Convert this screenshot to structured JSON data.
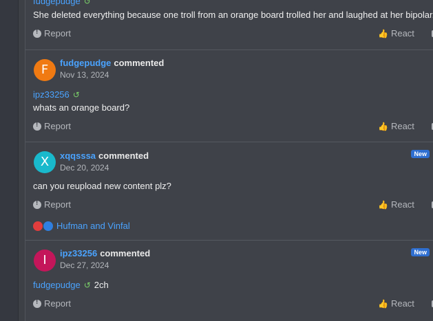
{
  "comments": [
    {
      "reply_to": "fudgepudge",
      "text": "She deleted everything because one troll from an orange board trolled her and laughed at her bipolar.",
      "report": "Report",
      "react": "React"
    },
    {
      "author": "fudgepudge",
      "verb": "commented",
      "date": "Nov 13, 2024",
      "avatar_letter": "F",
      "avatar_color": "#f07a12",
      "reply_to": "ipz33256",
      "text": "whats an orange board?",
      "report": "Report",
      "react": "React"
    },
    {
      "author": "xqqsssa",
      "verb": "commented",
      "date": "Dec 20, 2024",
      "avatar_letter": "X",
      "avatar_color": "#19b9cc",
      "badge": "New",
      "text": "can you reupload new content plz?",
      "report": "Report",
      "react": "React",
      "reactions_by": "Hufman and Vinfal"
    },
    {
      "author": "ipz33256",
      "verb": "commented",
      "date": "Dec 27, 2024",
      "avatar_letter": "I",
      "avatar_color": "#c4165a",
      "badge": "New",
      "reply_to": "fudgepudge",
      "text": "2ch",
      "report": "Report",
      "react": "React"
    }
  ],
  "colors": {
    "link": "#4aa3ff",
    "reply_icon": "#7bd069",
    "badge": "#2f6fd1",
    "reaction_dislike": "#e23d3d",
    "reaction_like": "#2f7fe0"
  },
  "icons": [
    "reply-arrow-icon",
    "report-icon",
    "thumbs-up-icon",
    "comment-icon",
    "dislike-reaction-icon",
    "like-reaction-icon"
  ]
}
